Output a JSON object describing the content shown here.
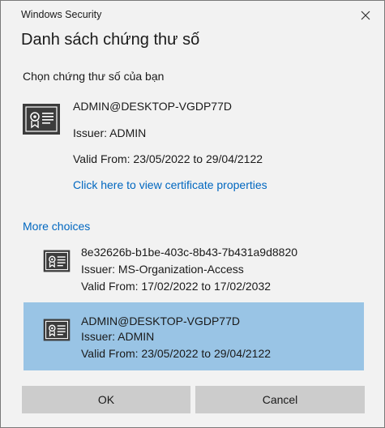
{
  "window": {
    "app_title": "Windows Security",
    "heading": "Danh sách chứng thư số",
    "subheading": "Chọn chứng thư số của bạn"
  },
  "selected_cert": {
    "name": "ADMIN@DESKTOP-VGDP77D",
    "issuer": "Issuer: ADMIN",
    "valid": "Valid From: 23/05/2022 to 29/04/2122",
    "properties_link": "Click here to view certificate properties"
  },
  "more_choices_label": "More choices",
  "choices": [
    {
      "name": "8e32626b-b1be-403c-8b43-7b431a9d8820",
      "issuer": "Issuer: MS-Organization-Access",
      "valid": "Valid From: 17/02/2022 to 17/02/2032",
      "selected": false
    },
    {
      "name": "ADMIN@DESKTOP-VGDP77D",
      "issuer": "Issuer: ADMIN",
      "valid": "Valid From: 23/05/2022 to 29/04/2122",
      "selected": true
    }
  ],
  "buttons": {
    "ok": "OK",
    "cancel": "Cancel"
  },
  "colors": {
    "accent_link": "#0067c0",
    "selection": "#99c4e5",
    "button_bg": "#cccccc",
    "dialog_bg": "#f2f2f2",
    "icon_dark": "#3c3c3c"
  },
  "icons": {
    "close": "close-icon",
    "certificate": "certificate-icon"
  }
}
